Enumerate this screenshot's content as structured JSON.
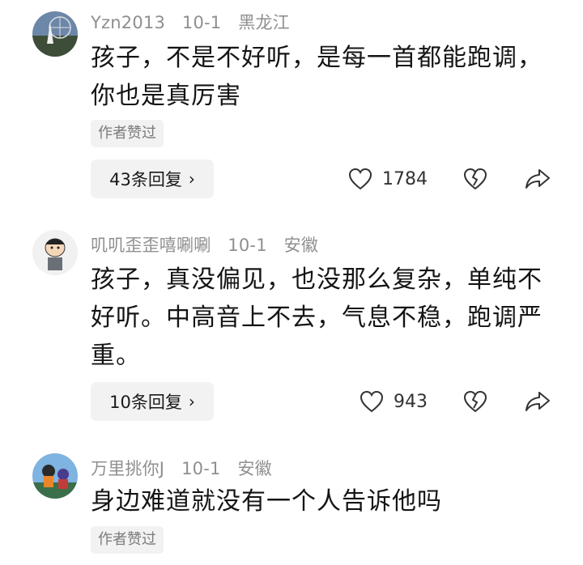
{
  "comments": [
    {
      "username": "Yzn2013",
      "date": "10-1",
      "location": "黑龙江",
      "text": "孩子，不是不好听，是每一首都能跑调，你也是真厉害",
      "badge": "作者赞过",
      "replies": "43条回复",
      "likes": "1784"
    },
    {
      "username": "叽叽歪歪嘻唰唰",
      "date": "10-1",
      "location": "安徽",
      "text": "孩子，真没偏见，也没那么复杂，单纯不好听。中高音上不去，气息不稳，跑调严重。",
      "replies": "10条回复",
      "likes": "943"
    },
    {
      "username": "万里挑你J",
      "date": "10-1",
      "location": "安徽",
      "text": "身边难道就没有一个人告诉他吗",
      "badge": "作者赞过"
    }
  ],
  "icons": {
    "like": "heart-outline-icon",
    "dislike": "broken-heart-icon",
    "share": "share-arrow-icon",
    "reply_more": "chevron-right-icon"
  },
  "colors": {
    "meta_text": "#8f8f8f",
    "pill_bg": "#f2f2f2"
  }
}
